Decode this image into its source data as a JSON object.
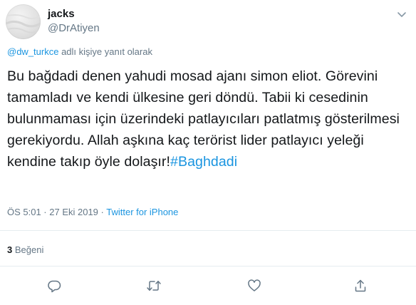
{
  "tweet": {
    "display_name": "jacks",
    "username": "@DrAtiyen",
    "reply_to": {
      "mention": "@dw_turkce",
      "suffix": "adlı kişiye yanıt olarak"
    },
    "text": "Bu bağdadi denen yahudi mosad ajanı simon eliot. Görevini tamamladı ve kendi ülkesine geri döndü. Tabii ki cesedinin bulunmaması için üzerindeki patlayıcıları patlatmış gösterilmesi gerekiyordu. Allah aşkına kaç terörist lider patlayıcı yeleği kendine takıp öyle dolaşır!",
    "hashtag": "#Baghdadi",
    "timestamp": "ÖS 5:01 · 27 Eki 2019 · ",
    "source": "Twitter for iPhone",
    "likes_count": "3",
    "likes_label": "Beğeni"
  },
  "icons": {
    "menu": "chevron-down-icon",
    "reply": "reply-icon",
    "retweet": "retweet-icon",
    "like": "heart-icon",
    "share": "share-icon"
  },
  "colors": {
    "link": "#1b95e0",
    "secondary_text": "#657786",
    "primary_text": "#14171a",
    "divider": "#e6ecf0"
  }
}
